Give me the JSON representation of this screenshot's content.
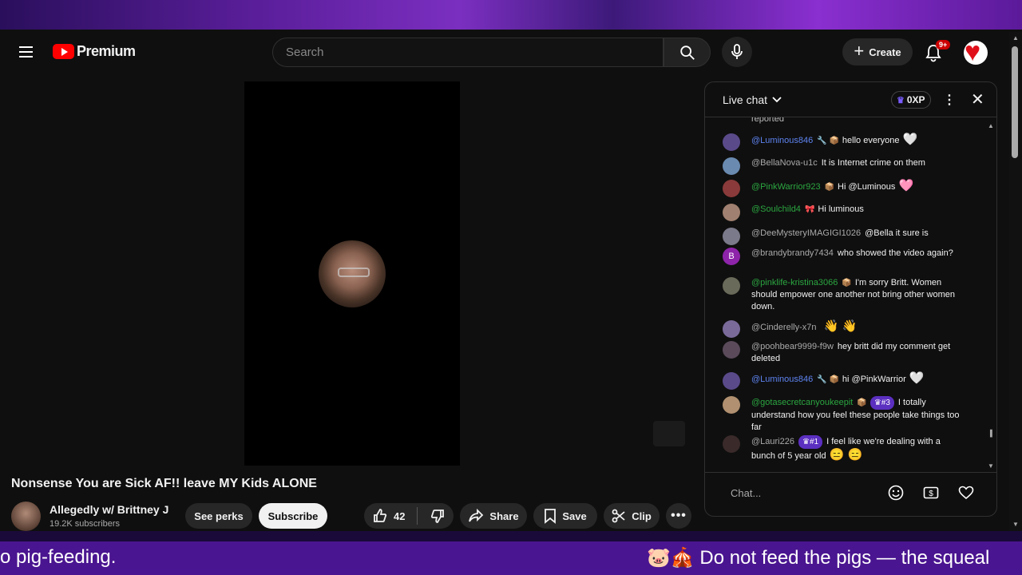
{
  "header": {
    "logo_text": "Premium",
    "search_placeholder": "Search",
    "create_label": "Create",
    "notifications_badge": "9+"
  },
  "video": {
    "title": "Nonsense You are Sick AF!! leave MY Kids ALONE",
    "channel_name": "Allegedly w/ Brittney J",
    "subscribers": "19.2K subscribers",
    "see_perks_label": "See perks",
    "subscribe_label": "Subscribe",
    "like_count": "42",
    "share_label": "Share",
    "save_label": "Save",
    "clip_label": "Clip"
  },
  "chat": {
    "title": "Live chat",
    "xp": "0XP",
    "clipped_text": "reported",
    "input_placeholder": "Chat...",
    "messages": [
      {
        "author": "@Luminous846",
        "role": "🔧 📦",
        "text": "hello everyone",
        "emoji": "🤍",
        "color": "blue",
        "avatar": "#5a4a8a"
      },
      {
        "author": "@BellaNova-u1c",
        "role": "",
        "text": "It is Internet crime on them",
        "emoji": "",
        "color": "gray",
        "avatar": "#6a8ab0"
      },
      {
        "author": "@PinkWarrior923",
        "role": "📦",
        "text": "Hi @Luminous",
        "emoji": "🩷",
        "color": "green",
        "avatar": "#8a3a3a"
      },
      {
        "author": "@Soulchild4",
        "role": "🎀",
        "text": "Hi luminous",
        "emoji": "",
        "color": "green",
        "avatar": "#a08070"
      },
      {
        "author": "@DeeMysteryIMAGIGI1026",
        "role": "",
        "text": "@Bella it sure is",
        "emoji": "",
        "color": "gray",
        "avatar": "#7a7a8a"
      },
      {
        "author": "@brandybrandy7434",
        "role": "",
        "text": "who showed the video again?",
        "emoji": "",
        "color": "gray",
        "avatar": "#8e24aa",
        "initial": "B"
      },
      {
        "author": "@pinklife-kristina3066",
        "role": "📦",
        "text": "I'm sorry Britt. Women should empower one another not bring other women down.",
        "emoji": "",
        "color": "green",
        "avatar": "#6a6a5a"
      },
      {
        "author": "@Cinderelly-x7n",
        "role": "",
        "text": "",
        "emoji": "👋 👋",
        "color": "gray",
        "avatar": "#7a6a9a"
      },
      {
        "author": "@poohbear9999-f9w",
        "role": "",
        "text": "hey britt did my comment get deleted",
        "emoji": "",
        "color": "gray",
        "avatar": "#5a4a5a"
      },
      {
        "author": "@Luminous846",
        "role": "🔧 📦",
        "text": "hi @PinkWarrior",
        "emoji": "🤍",
        "color": "blue",
        "avatar": "#5a4a8a"
      },
      {
        "author": "@gotasecretcanyoukeepit",
        "role": "📦",
        "rank": "#3",
        "text": "I totally understand how you feel these people take things too far",
        "emoji": "",
        "color": "green",
        "avatar": "#b09070"
      },
      {
        "author": "@Lauri226",
        "role": "",
        "rank": "#1",
        "text": "I feel like we're dealing with a bunch of 5 year old",
        "emoji": "😑 😑",
        "color": "gray",
        "avatar": "#3a2a2a"
      }
    ]
  },
  "ticker": {
    "left_text": "o pig-feeding.",
    "right_text": "🐷🎪 Do not feed the pigs — the squeal"
  },
  "colors": {
    "brand_red": "#ff0000",
    "accent_purple": "#4a1590"
  }
}
